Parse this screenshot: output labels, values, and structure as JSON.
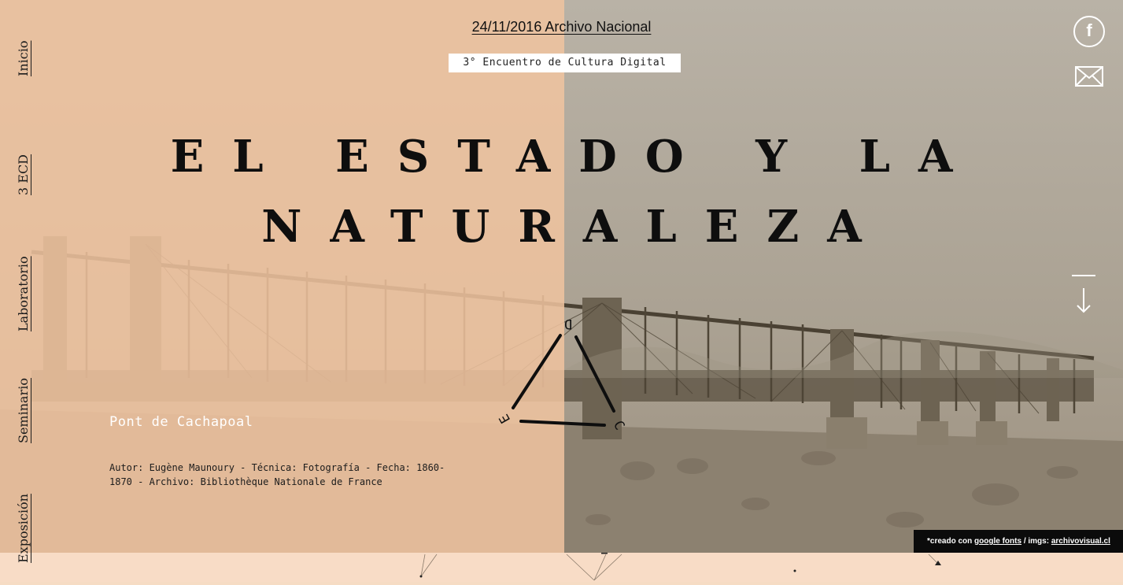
{
  "nav": {
    "items": [
      {
        "label": "Inicio"
      },
      {
        "label": "3 ECD"
      },
      {
        "label": "Laboratorio"
      },
      {
        "label": "Seminario"
      },
      {
        "label": "Exposición"
      }
    ]
  },
  "header": {
    "date_line": "24/11/2016 Archivo Nacional",
    "subtitle": "3° Encuentro de Cultura Digital"
  },
  "hero": {
    "title_line1": "EL ESTADO Y LA",
    "title_line2": "NATURALEZA",
    "logo_letters": [
      "D",
      "C",
      "E"
    ]
  },
  "caption": {
    "title": "Pont de Cachapoal",
    "meta": "Autor: Eugène Maunoury - Técnica: Fotografía - Fecha: 1860-1870 - Archivo: Bibliothèque Nationale de France"
  },
  "icons": {
    "facebook": "facebook-icon",
    "mail": "mail-icon",
    "scroll": "arrow-down-icon"
  },
  "credit": {
    "prefix": "*creado con",
    "fonts_link": "google fonts",
    "separator": "/ imgs:",
    "imgs_link": "archivovisual.cl"
  },
  "colors": {
    "overlay_peach": "#f0c4a0",
    "photo_sepia": "#bcb2a4",
    "band": "#f8dcc6"
  }
}
